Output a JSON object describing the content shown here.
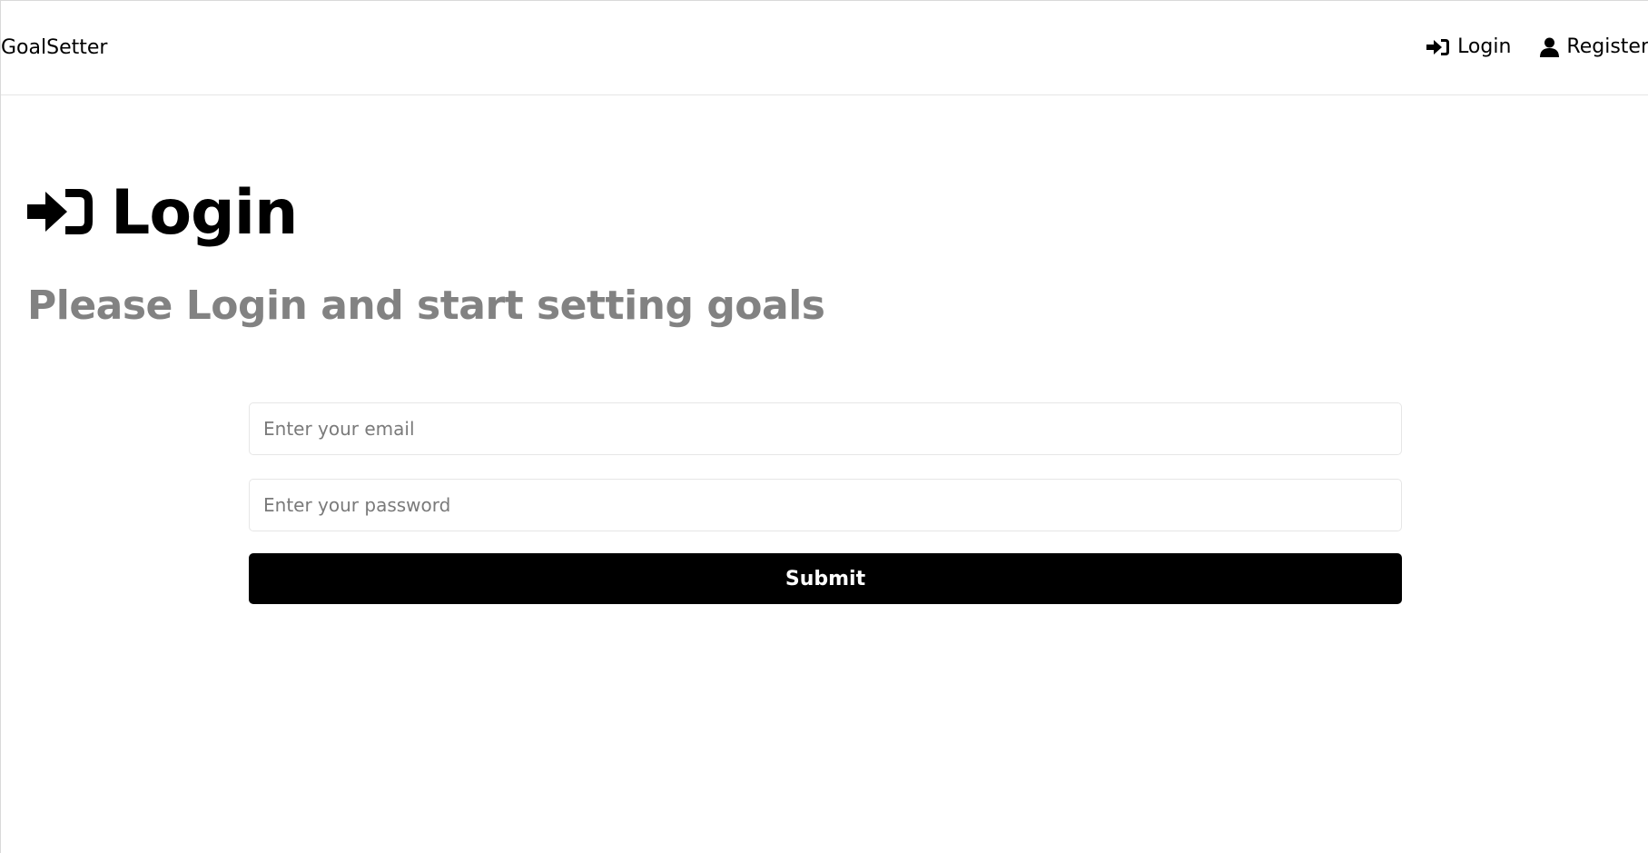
{
  "header": {
    "brand": "GoalSetter",
    "nav": {
      "login_label": "Login",
      "login_icon": "sign-in-icon",
      "register_label": "Register",
      "register_icon": "user-icon"
    }
  },
  "main": {
    "heading": "Login",
    "heading_icon": "sign-in-icon",
    "subtitle": "Please Login and start setting goals"
  },
  "form": {
    "email_placeholder": "Enter your email",
    "email_value": "",
    "password_placeholder": "Enter your password",
    "password_value": "",
    "submit_label": "Submit"
  },
  "colors": {
    "text": "#000000",
    "subtitle": "#828282",
    "button_bg": "#000000",
    "button_text": "#ffffff",
    "border": "#e6e6e6"
  }
}
